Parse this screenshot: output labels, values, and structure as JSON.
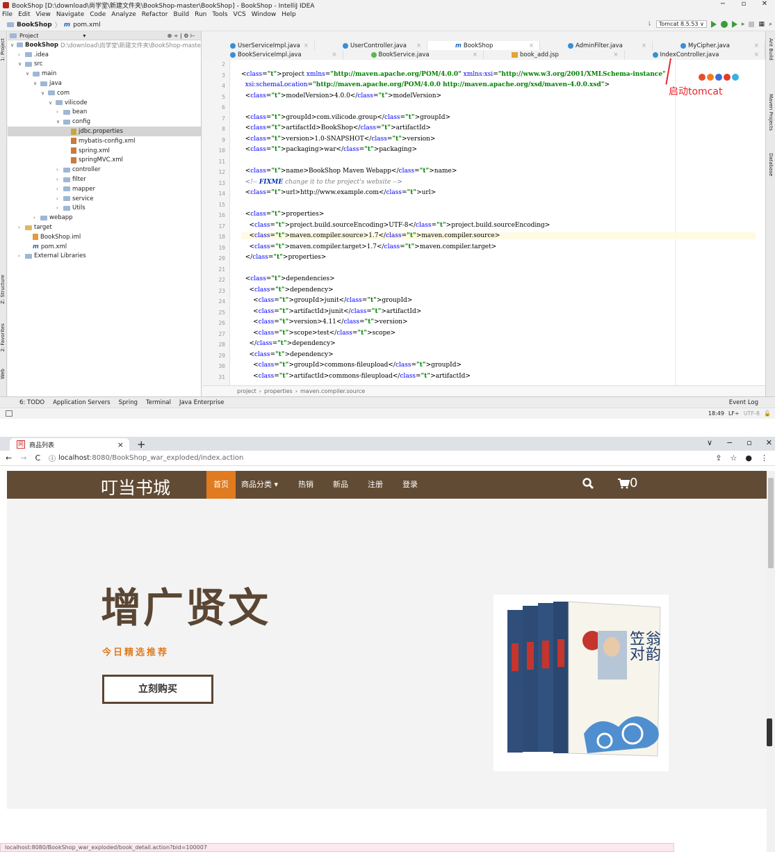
{
  "ide": {
    "title": "BookShop [D:\\download\\尚学堂\\新建文件夹\\BookShop-master\\BookShop] - BookShop - IntelliJ IDEA",
    "menu": [
      "File",
      "Edit",
      "View",
      "Navigate",
      "Code",
      "Analyze",
      "Refactor",
      "Build",
      "Run",
      "Tools",
      "VCS",
      "Window",
      "Help"
    ],
    "breadcrumb_project": "BookShop",
    "breadcrumb_file": "pom.xml",
    "run_config": "Tomcat 8.5.53 ∨",
    "project_panel_label": "Project",
    "tree": [
      {
        "label": "BookShop",
        "extra": "D:\\download\\尚学堂\\新建文件夹\\BookShop-maste",
        "indent": 0,
        "arrow": "∨",
        "icon": "folder",
        "bold": true
      },
      {
        "label": ".idea",
        "indent": 1,
        "arrow": ">",
        "icon": "folder"
      },
      {
        "label": "src",
        "indent": 1,
        "arrow": "∨",
        "icon": "folder"
      },
      {
        "label": "main",
        "indent": 2,
        "arrow": "∨",
        "icon": "folder"
      },
      {
        "label": "java",
        "indent": 3,
        "arrow": "∨",
        "icon": "folder"
      },
      {
        "label": "com",
        "indent": 4,
        "arrow": "∨",
        "icon": "folder"
      },
      {
        "label": "vilicode",
        "indent": 5,
        "arrow": "∨",
        "icon": "folder"
      },
      {
        "label": "bean",
        "indent": 6,
        "arrow": ">",
        "icon": "folder"
      },
      {
        "label": "config",
        "indent": 6,
        "arrow": "∨",
        "icon": "folder"
      },
      {
        "label": "jdbc.properties",
        "indent": 7,
        "arrow": "",
        "icon": "prop",
        "sel": true
      },
      {
        "label": "mybatis-config.xml",
        "indent": 7,
        "arrow": "",
        "icon": "xml"
      },
      {
        "label": "spring.xml",
        "indent": 7,
        "arrow": "",
        "icon": "xml"
      },
      {
        "label": "springMVC.xml",
        "indent": 7,
        "arrow": "",
        "icon": "xml"
      },
      {
        "label": "controller",
        "indent": 6,
        "arrow": ">",
        "icon": "folder"
      },
      {
        "label": "filter",
        "indent": 6,
        "arrow": ">",
        "icon": "folder"
      },
      {
        "label": "mapper",
        "indent": 6,
        "arrow": ">",
        "icon": "folder"
      },
      {
        "label": "service",
        "indent": 6,
        "arrow": ">",
        "icon": "folder"
      },
      {
        "label": "Utils",
        "indent": 6,
        "arrow": ">",
        "icon": "folder"
      },
      {
        "label": "webapp",
        "indent": 3,
        "arrow": ">",
        "icon": "folder"
      },
      {
        "label": "target",
        "indent": 1,
        "arrow": ">",
        "icon": "folder-y"
      },
      {
        "label": "BookShop.iml",
        "indent": 2,
        "arrow": "",
        "icon": "iml"
      },
      {
        "label": "pom.xml",
        "indent": 2,
        "arrow": "",
        "icon": "mvn"
      },
      {
        "label": "External Libraries",
        "indent": 1,
        "arrow": ">",
        "icon": "lib"
      }
    ],
    "tabs_row1": [
      {
        "label": "UserServiceImpl.java",
        "icon": "c"
      },
      {
        "label": "UserController.java",
        "icon": "c"
      },
      {
        "label": "BookShop",
        "icon": "m",
        "active": true
      },
      {
        "label": "AdminFilter.java",
        "icon": "c"
      },
      {
        "label": "MyCipher.java",
        "icon": "c"
      }
    ],
    "tabs_row2": [
      {
        "label": "BookServiceImpl.java",
        "icon": "c"
      },
      {
        "label": "BookService.java",
        "icon": "i"
      },
      {
        "label": "book_add.jsp",
        "icon": "j"
      },
      {
        "label": "IndexController.java",
        "icon": "c"
      }
    ],
    "line_numbers": [
      "2",
      "3",
      "4",
      "5",
      "6",
      "7",
      "8",
      "9",
      "10",
      "11",
      "12",
      "13",
      "14",
      "15",
      "16",
      "17",
      "18",
      "19",
      "20",
      "21",
      "22",
      "23",
      "24",
      "25",
      "26",
      "27",
      "28",
      "29",
      "30",
      "31"
    ],
    "code_lines": [
      "",
      "<project xmlns=\"http://maven.apache.org/POM/4.0.0\" xmlns:xsi=\"http://www.w3.org/2001/XMLSchema-instance\"",
      "  xsi:schemaLocation=\"http://maven.apache.org/POM/4.0.0 http://maven.apache.org/xsd/maven-4.0.0.xsd\">",
      "  <modelVersion>4.0.0</modelVersion>",
      "",
      "  <groupId>com.vilicode.group</groupId>",
      "  <artifactId>BookShop</artifactId>",
      "  <version>1.0-SNAPSHOT</version>",
      "  <packaging>war</packaging>",
      "",
      "  <name>BookShop Maven Webapp</name>",
      "  <!-- FIXME change it to the project's website -->",
      "  <url>http://www.example.com</url>",
      "",
      "  <properties>",
      "    <project.build.sourceEncoding>UTF-8</project.build.sourceEncoding>",
      "    <maven.compiler.source>1.7</maven.compiler.source>",
      "    <maven.compiler.target>1.7</maven.compiler.target>",
      "  </properties>",
      "",
      "  <dependencies>",
      "    <dependency>",
      "      <groupId>junit</groupId>",
      "      <artifactId>junit</artifactId>",
      "      <version>4.11</version>",
      "      <scope>test</scope>",
      "    </dependency>",
      "    <dependency>",
      "      <groupId>commons-fileupload</groupId>",
      "      <artifactId>commons-fileupload</artifactId>"
    ],
    "highlight_line_index": 16,
    "annotation": "启动tomcat",
    "editor_crumbs": [
      "project",
      "properties",
      "maven.compiler.source"
    ],
    "bottom_tools": [
      "6: TODO",
      "Application Servers",
      "Spring",
      "Terminal",
      "Java Enterprise"
    ],
    "event_log": "Event Log",
    "status_time": "18:49",
    "status_lf": "LF÷",
    "status_enc": "UTF-8",
    "left_strip": [
      "1: Project",
      "Z: Structure",
      "2: Favorites",
      "Web"
    ],
    "right_strip": [
      "Ant Build",
      "Maven Projects",
      "Database"
    ]
  },
  "browser": {
    "tab_title": "商品列表",
    "url_host": "localhost",
    "url_path": ":8080/BookShop_war_exploded/index.action",
    "status_url": "localhost:8080/BookShop_war_exploded/book_detail.action?bid=100007"
  },
  "site": {
    "brand": "叮当书城",
    "nav": [
      {
        "label": "首页",
        "active": true
      },
      {
        "label": "商品分类 ▾"
      },
      {
        "label": "热销"
      },
      {
        "label": "新品"
      },
      {
        "label": "注册"
      },
      {
        "label": "登录"
      }
    ],
    "cart_count": "0",
    "hero_title": "增广贤文",
    "hero_subtitle": "今日精选推荐",
    "buy_button": "立刻购买",
    "book_cover_text": [
      "笠",
      "翁",
      "对",
      "韵"
    ],
    "spine_texts": [
      "增广贤文",
      "幼学琼林",
      "声律启蒙",
      "笠翁对韵",
      "大字版"
    ]
  },
  "colors": {
    "site_nav_bg": "#614b34",
    "site_nav_active": "#e07b1f",
    "hero_bg": "#f3f3f3",
    "hero_title": "#5a4633",
    "annotation": "#e8242c"
  }
}
